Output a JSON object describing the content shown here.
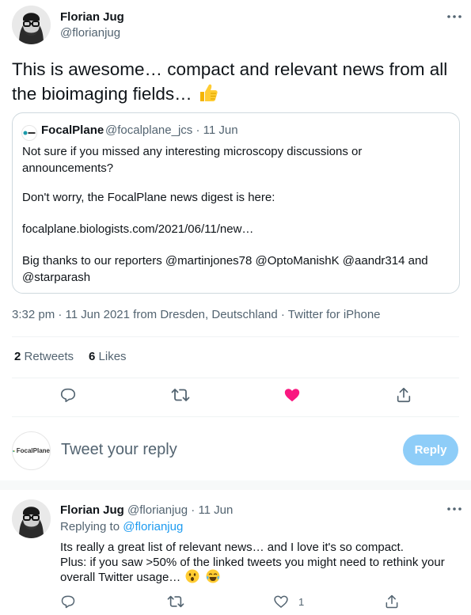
{
  "tweet": {
    "author_name": "Florian Jug",
    "author_handle": "@florianjug",
    "text": "This is awesome… compact and relevant news from all the bioimaging fields…",
    "text_emoji": "thumbs-up",
    "meta": "3:32 pm · 11 Jun 2021 from Dresden, Deutschland · Twitter for iPhone",
    "retweets_count": "2",
    "retweets_label": "Retweets",
    "likes_count": "6",
    "likes_label": "Likes"
  },
  "quote": {
    "name": "FocalPlane",
    "handle_date": "@focalplane_jcs · 11 Jun",
    "line1": "Not sure if you missed any interesting microscopy discussions or",
    "line2": "announcements?",
    "line3": "Don't worry, the FocalPlane news digest is here:",
    "line4": "focalplane.biologists.com/2021/06/11/new…",
    "line5": "Big thanks to our reporters @martinjones78 @OptoManishK @aandr314 and",
    "line6": "@starparash"
  },
  "reply_box": {
    "avatar_text": "FocalPlane",
    "placeholder": "Tweet your reply",
    "button_label": "Reply"
  },
  "reply": {
    "author_name": "Florian Jug",
    "handle_date": "@florianjug · 11 Jun",
    "replying_prefix": "Replying to",
    "replying_handle": "@florianjug",
    "line1": "Its really a great list of relevant news… and I love it's so compact.",
    "line2": "Plus: if you saw >50% of the linked tweets you might need to rethink your",
    "line3": "overall Twitter usage…",
    "emojis": [
      "astonished-face",
      "tears-of-joy-face"
    ],
    "likes_count": "1"
  },
  "colors": {
    "like_active": "#f91880",
    "link": "#1d9bf0",
    "reply_button": "#8ecdf8"
  }
}
